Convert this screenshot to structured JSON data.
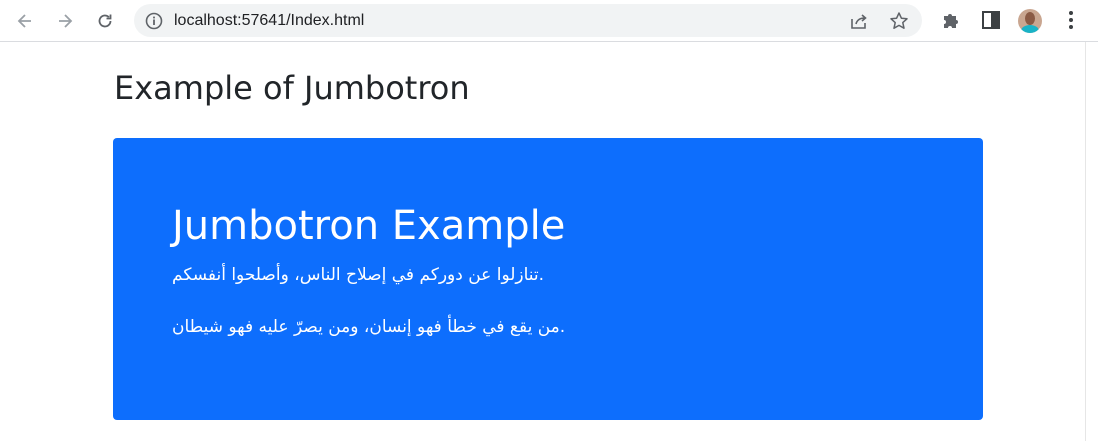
{
  "browser": {
    "url": "localhost:57641/Index.html",
    "icons": [
      "back-arrow-icon",
      "forward-arrow-icon",
      "reload-icon",
      "info-icon",
      "share-icon",
      "star-icon",
      "puzzle-icon",
      "side-panel-icon",
      "kebab-menu-icon"
    ]
  },
  "page": {
    "title": "Example of Jumbotron",
    "jumbotron": {
      "heading": "Jumbotron Example",
      "paragraph_1": "تنازلوا عن دوركم في إصلاح الناس، وأصلحوا أنفسكم.",
      "paragraph_2": "من يقع في خطأ فهو إنسان، ومن يصرّ عليه فهو شيطان."
    }
  },
  "colors": {
    "jumbotron_bg": "#0d6efd",
    "jumbotron_text": "#ffffff",
    "title_text": "#212529",
    "omnibox_bg": "#f1f3f4"
  }
}
